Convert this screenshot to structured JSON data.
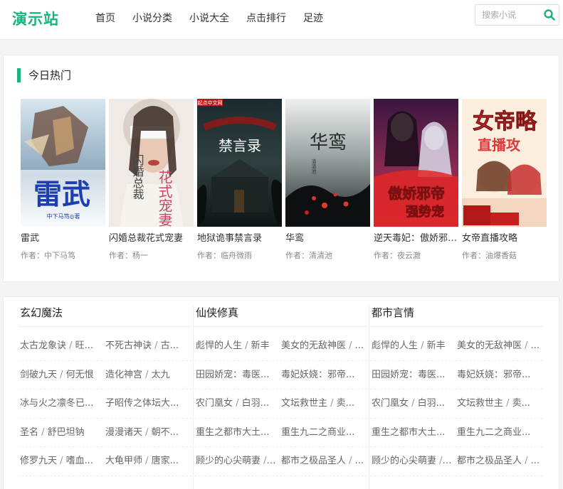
{
  "header": {
    "logo": "演示站",
    "nav": [
      "首页",
      "小说分类",
      "小说大全",
      "点击排行",
      "足迹"
    ],
    "search_placeholder": "搜索小说",
    "accent_color": "#19b37b"
  },
  "hot": {
    "title": "今日热门",
    "author_prefix": "作者：",
    "books": [
      {
        "title": "雷武",
        "author": "中下马笃",
        "cover_text": "雷武",
        "cover_sub": "中下马笃◎著"
      },
      {
        "title": "闪婚总裁花式宠妻",
        "author": "杨一",
        "cover_text": "闪婚总裁",
        "cover_sub": "花式宠妻"
      },
      {
        "title": "地狱诡事禁言录",
        "author": "临舟微雨",
        "cover_text": "禁言录",
        "cover_sub": "起点中文网"
      },
      {
        "title": "华鸾",
        "author": "清清池",
        "cover_text": "华鸾",
        "cover_sub": "清清池"
      },
      {
        "title": "逆天毒妃：傲娇邪帝强势宠",
        "author": "夜云澈",
        "cover_text": "傲娇邪帝",
        "cover_sub": "强势宠"
      },
      {
        "title": "女帝直播攻略",
        "author": "油爆香菇",
        "cover_text": "女帝略",
        "cover_sub": "直播攻"
      }
    ]
  },
  "categories": [
    {
      "title": "玄幻魔法",
      "rows": [
        [
          {
            "name": "太古龙象诀",
            "author": "旺..."
          },
          {
            "name": "不死古神诀",
            "author": "古..."
          }
        ],
        [
          {
            "name": "剑破九天",
            "author": "何无恨"
          },
          {
            "name": "造化神宫",
            "author": "太九"
          }
        ],
        [
          {
            "name": "冰与火之凛冬已...",
            "author": ""
          },
          {
            "name": "子昭传之体坛大...",
            "author": ""
          }
        ],
        [
          {
            "name": "圣名",
            "author": "舒巴坦钠"
          },
          {
            "name": "漫漫诸天",
            "author": "朝不..."
          }
        ],
        [
          {
            "name": "修罗九天",
            "author": "嗜血..."
          },
          {
            "name": "大龟甲师",
            "author": "唐家..."
          }
        ]
      ]
    },
    {
      "title": "仙侠修真",
      "rows": [
        [
          {
            "name": "彪悍的人生",
            "author": "新丰"
          },
          {
            "name": "美女的无敌神医",
            "author": "..."
          }
        ],
        [
          {
            "name": "田园娇宠：毒医...",
            "author": ""
          },
          {
            "name": "毒妃妖娆：邪帝...",
            "author": ""
          }
        ],
        [
          {
            "name": "农门凰女",
            "author": "白羽..."
          },
          {
            "name": "文坛救世主",
            "author": "卖..."
          }
        ],
        [
          {
            "name": "重生之都市大土...",
            "author": ""
          },
          {
            "name": "重生九二之商业...",
            "author": ""
          }
        ],
        [
          {
            "name": "顾少的心尖萌妻",
            "author": "..."
          },
          {
            "name": "都市之极品圣人",
            "author": "..."
          }
        ]
      ]
    },
    {
      "title": "都市言情",
      "rows": [
        [
          {
            "name": "彪悍的人生",
            "author": "新丰"
          },
          {
            "name": "美女的无敌神医",
            "author": "..."
          }
        ],
        [
          {
            "name": "田园娇宠：毒医...",
            "author": ""
          },
          {
            "name": "毒妃妖娆：邪帝...",
            "author": ""
          }
        ],
        [
          {
            "name": "农门凰女",
            "author": "白羽..."
          },
          {
            "name": "文坛救世主",
            "author": "卖..."
          }
        ],
        [
          {
            "name": "重生之都市大土...",
            "author": ""
          },
          {
            "name": "重生九二之商业...",
            "author": ""
          }
        ],
        [
          {
            "name": "顾少的心尖萌妻",
            "author": "..."
          },
          {
            "name": "都市之极品圣人",
            "author": "..."
          }
        ]
      ]
    }
  ]
}
